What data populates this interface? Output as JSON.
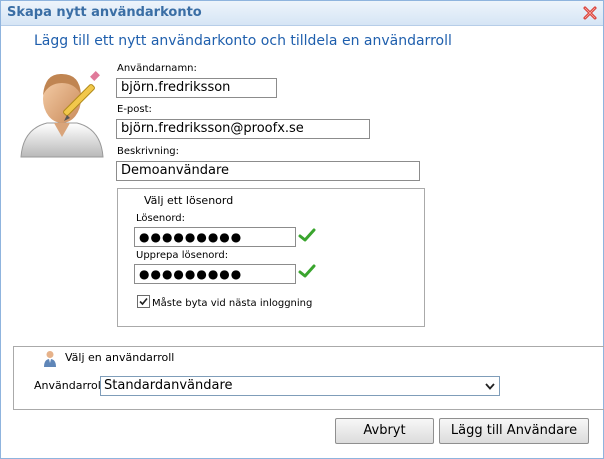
{
  "dialog": {
    "title": "Skapa nytt användarkonto",
    "heading": "Lägg till ett nytt användarkonto och tilldela en användarroll"
  },
  "form": {
    "username_label": "Användarnamn:",
    "username_value": "björn.fredriksson",
    "email_label": "E-post:",
    "email_value": "björn.fredriksson@proofx.se",
    "description_label": "Beskrivning:",
    "description_value": "Demoanvändare"
  },
  "password_section": {
    "legend": "Välj ett lösenord",
    "password_label": "Lösenord:",
    "password_value": "●●●●●●●●●",
    "repeat_label": "Upprepa lösenord:",
    "repeat_value": "●●●●●●●●●",
    "must_change_label": "Måste byta vid nästa inloggning",
    "must_change_checked": true
  },
  "role_section": {
    "heading": "Välj en användarroll",
    "role_label": "Användarroll:",
    "role_value": "Standardanvändare"
  },
  "buttons": {
    "cancel": "Avbryt",
    "add_user": "Lägg till Användare"
  },
  "colors": {
    "title_text": "#3a6ea5",
    "heading_text": "#1f5fad",
    "valid_check": "#3aa52e",
    "close_icon": "#d8332b"
  }
}
